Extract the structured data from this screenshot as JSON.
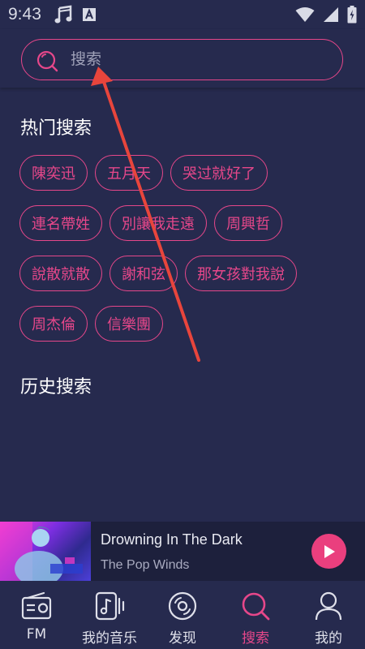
{
  "status_bar": {
    "time": "9:43",
    "notification_icons": [
      "music-note-icon",
      "font-a-icon"
    ],
    "system_icons": [
      "wifi-icon",
      "signal-icon",
      "battery-icon"
    ]
  },
  "search": {
    "placeholder": "搜索"
  },
  "hot_search": {
    "title": "热门搜索",
    "rows": [
      [
        "陳奕迅",
        "五月天",
        "哭过就好了"
      ],
      [
        "連名帶姓",
        "別讓我走遠",
        "周興哲"
      ],
      [
        "說散就散",
        "謝和弦",
        "那女孩對我說"
      ],
      [
        "周杰倫",
        "信樂團"
      ]
    ]
  },
  "history_search": {
    "title": "历史搜索"
  },
  "now_playing": {
    "title": "Drowning In The Dark",
    "artist": "The Pop Winds"
  },
  "bottom_nav": {
    "items": [
      {
        "label": "FM",
        "icon": "radio-icon"
      },
      {
        "label": "我的音乐",
        "icon": "my-music-icon"
      },
      {
        "label": "发现",
        "icon": "disc-icon"
      },
      {
        "label": "搜索",
        "icon": "search-icon"
      },
      {
        "label": "我的",
        "icon": "person-icon"
      }
    ],
    "active_index": 3
  },
  "colors": {
    "accent": "#e6478a",
    "background": "#262a4e",
    "annotation_arrow": "#e8453c"
  }
}
